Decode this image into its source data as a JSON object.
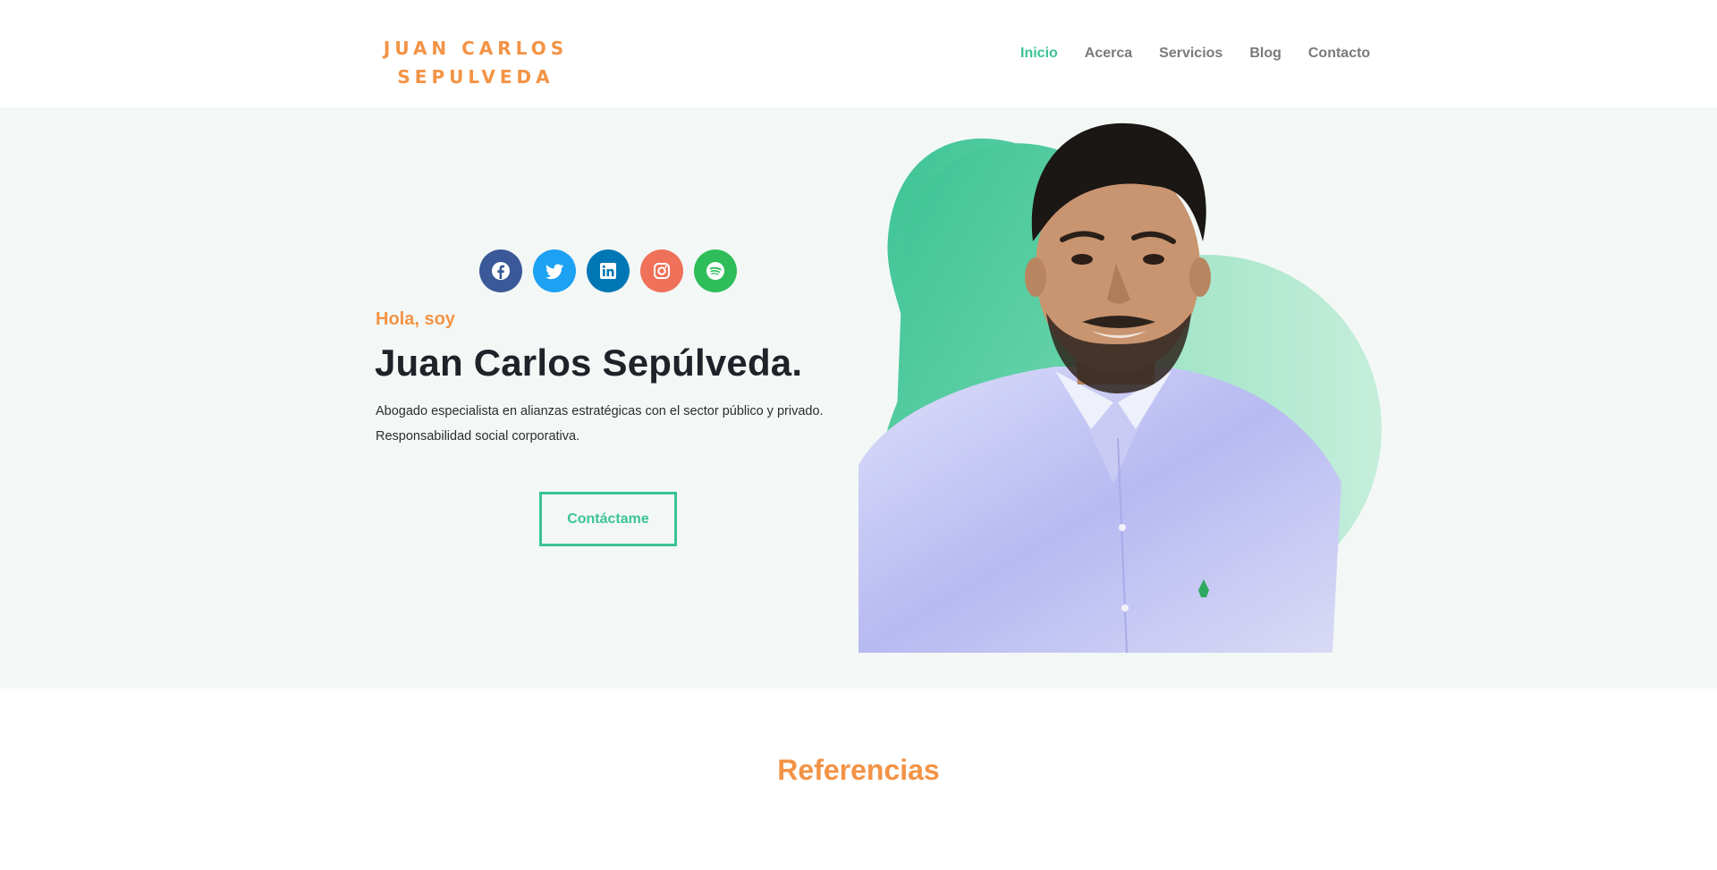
{
  "header": {
    "logo_line1": "JUAN CARLOS",
    "logo_line2": "SEPULVEDA",
    "nav": [
      {
        "label": "Inicio",
        "active": true
      },
      {
        "label": "Acerca",
        "active": false
      },
      {
        "label": "Servicios",
        "active": false
      },
      {
        "label": "Blog",
        "active": false
      },
      {
        "label": "Contacto",
        "active": false
      }
    ]
  },
  "hero": {
    "socials": [
      {
        "icon": "facebook-icon",
        "color": "#3b5998"
      },
      {
        "icon": "twitter-icon",
        "color": "#1da1f2"
      },
      {
        "icon": "linkedin-icon",
        "color": "#0077b5"
      },
      {
        "icon": "instagram-icon",
        "color": "#ef7159"
      },
      {
        "icon": "spotify-icon",
        "color": "#2ebd59"
      }
    ],
    "greeting": "Hola, soy",
    "name": "Juan Carlos Sepúlveda.",
    "description_line1": "Abogado especialista en alianzas estratégicas con el sector público y privado.",
    "description_line2": "Responsabilidad social corporativa.",
    "cta_label": "Contáctame"
  },
  "references": {
    "title": "Referencias"
  },
  "colors": {
    "accent_orange": "#f39345",
    "accent_green": "#3cc395",
    "hero_bg": "#f3f8f6",
    "heading": "#1f2228",
    "nav_text": "#7a7a7a"
  }
}
